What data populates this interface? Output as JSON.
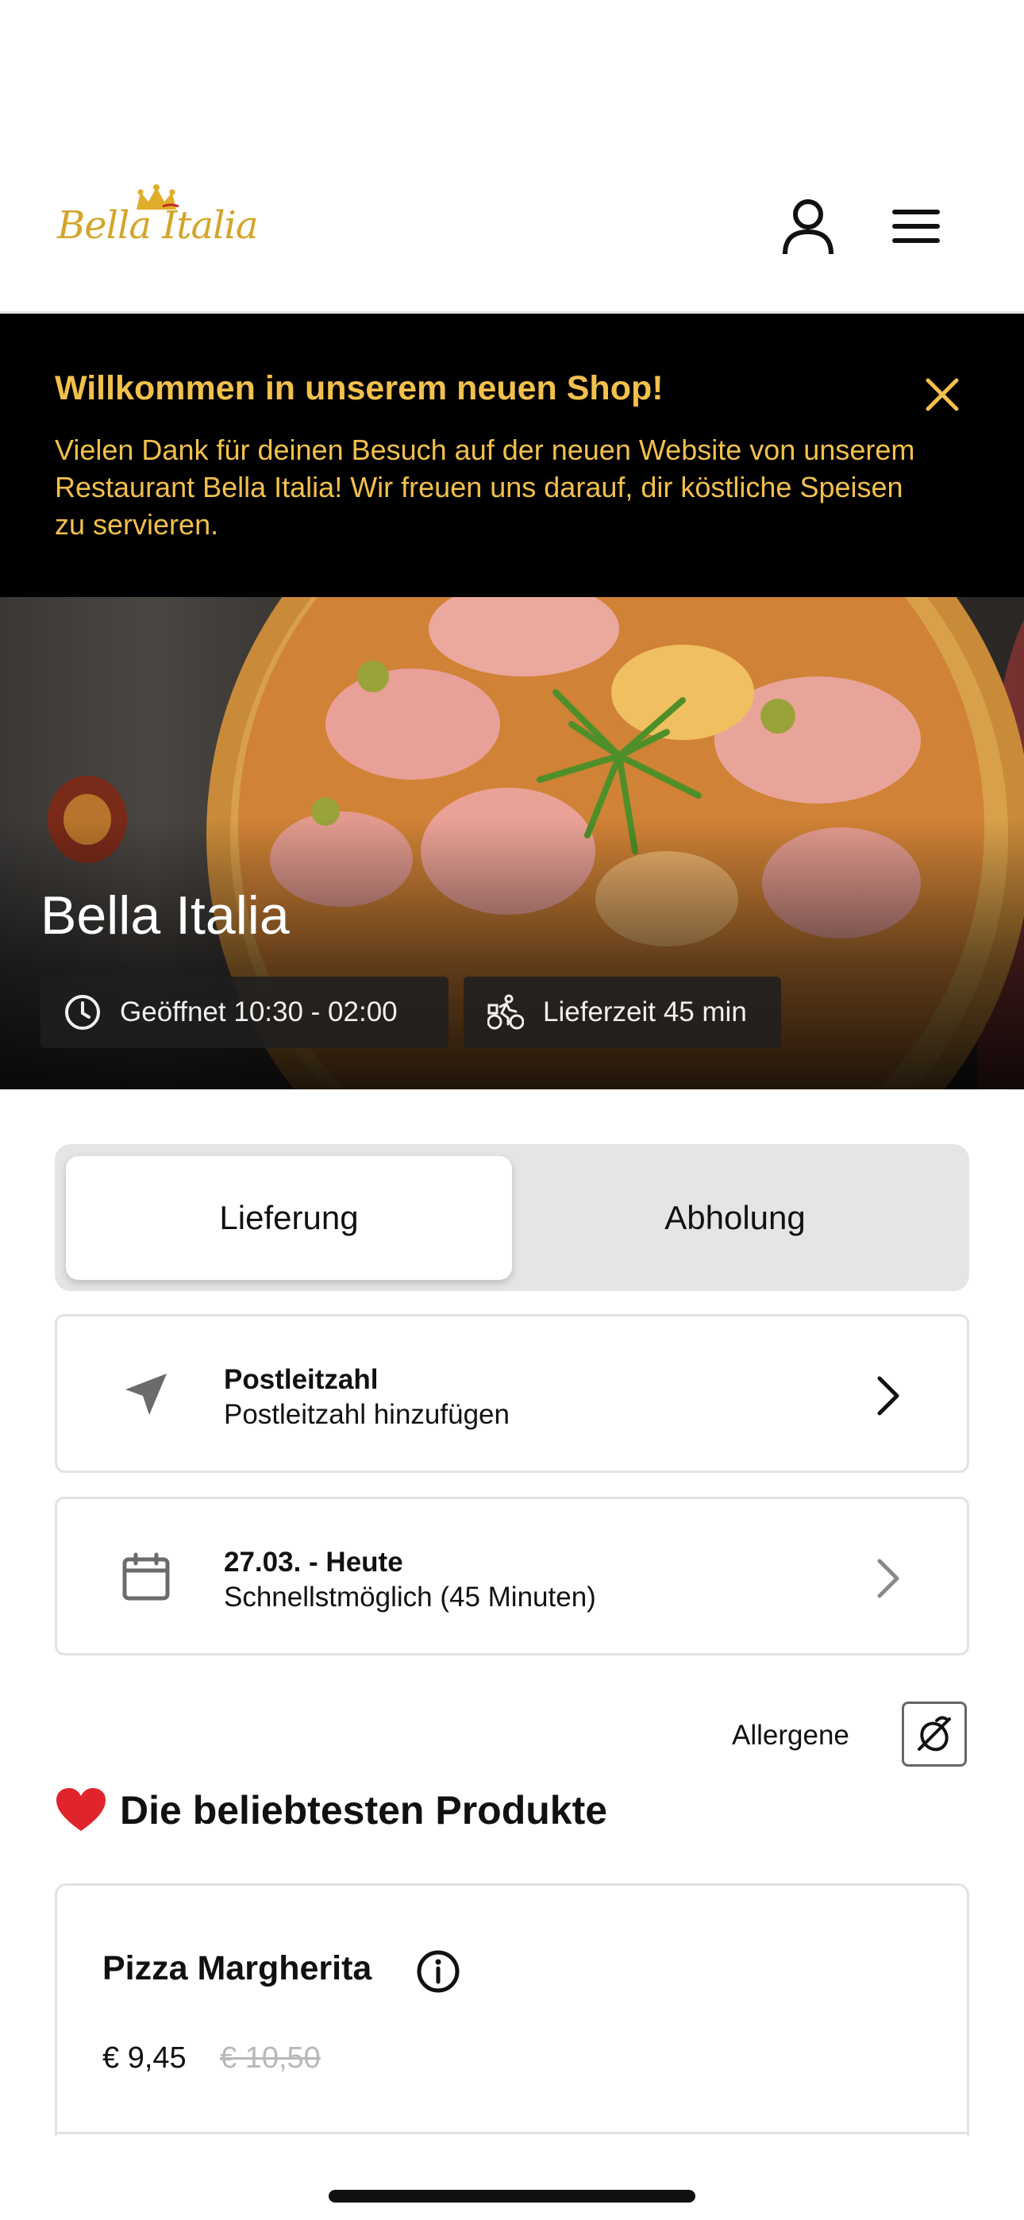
{
  "header": {
    "logo_text": "Bella Italia",
    "user_icon": "user-icon",
    "menu_icon": "hamburger-menu-icon"
  },
  "banner": {
    "title": "Willkommen in unserem neuen Shop!",
    "text": "Vielen Dank für deinen Besuch auf der neuen Website von unserem Restaurant Bella Italia! Wir freuen uns darauf, dir köstliche Speisen zu servieren.",
    "close_icon": "close-icon",
    "text_color": "#f2c04c",
    "background": "#000000"
  },
  "hero": {
    "title": "Bella Italia",
    "opening_hours": "Geöffnet 10:30 - 02:00",
    "delivery_time": "Lieferzeit 45 min"
  },
  "order_mode": {
    "options": [
      "Lieferung",
      "Abholung"
    ],
    "selected": "Lieferung"
  },
  "postal": {
    "title": "Postleitzahl",
    "subtitle": "Postleitzahl hinzufügen",
    "icon": "location-arrow-icon"
  },
  "date": {
    "title": "27.03. - Heute",
    "subtitle": "Schnellstmöglich (45 Minuten)",
    "icon": "calendar-icon"
  },
  "allergens": {
    "label": "Allergene",
    "icon": "allergen-filter-icon"
  },
  "section": {
    "title": "Die beliebtesten Produkte",
    "icon": "heart-icon"
  },
  "products": [
    {
      "name": "Pizza Margherita",
      "price": "€ 9,45",
      "old_price": "€ 10,50"
    }
  ]
}
